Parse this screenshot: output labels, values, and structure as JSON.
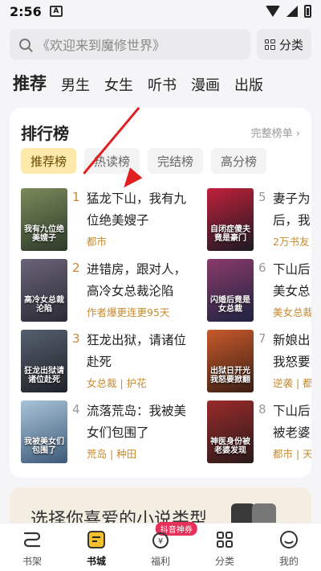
{
  "status_bar": {
    "time": "2:56",
    "notification_letter": "A"
  },
  "search": {
    "placeholder": "《欢迎来到魔修世界》",
    "category_label": "分类"
  },
  "top_tabs": [
    {
      "label": "推荐",
      "active": true
    },
    {
      "label": "男生",
      "active": false
    },
    {
      "label": "女生",
      "active": false
    },
    {
      "label": "听书",
      "active": false
    },
    {
      "label": "漫画",
      "active": false
    },
    {
      "label": "出版",
      "active": false
    }
  ],
  "ranking": {
    "title": "排行榜",
    "more_label": "完整榜单",
    "tabs": [
      {
        "label": "推荐榜",
        "active": true
      },
      {
        "label": "热读榜",
        "active": false
      },
      {
        "label": "完结榜",
        "active": false
      },
      {
        "label": "高分榜",
        "active": false
      }
    ],
    "left_books": [
      {
        "rank": "1",
        "title": "猛龙下山，我有九位绝美嫂子",
        "tag": "都市",
        "cover_text": "我有九位绝美嫂子",
        "cover_colors": [
          "#2d3a2a",
          "#7a8a5a"
        ]
      },
      {
        "rank": "2",
        "title": "进错房，跟对人，高冷女总裁沦陷",
        "tag": "作者爆更连更95天",
        "cover_text": "高冷女总裁沦陷",
        "cover_colors": [
          "#2a2a35",
          "#6a6478"
        ]
      },
      {
        "rank": "3",
        "title": "狂龙出狱，请诸位赴死",
        "tag": "女总裁 | 护花",
        "cover_text": "狂龙出狱请诸位赴死",
        "cover_colors": [
          "#1f2229",
          "#55606e"
        ]
      },
      {
        "rank": "4",
        "title": "流落荒岛：我被美女们包围了",
        "tag": "荒岛 | 种田",
        "cover_text": "我被美女们包围了",
        "cover_colors": [
          "#3d5a78",
          "#a9c3d8"
        ]
      }
    ],
    "right_books": [
      {
        "rank": "5",
        "title": "妻子为后，我",
        "tag": "2万书友",
        "cover_text": "自闭症傻夫竟是豪门",
        "cover_colors": [
          "#1a1a22",
          "#c0203a"
        ]
      },
      {
        "rank": "6",
        "title": "下山后美女总",
        "tag": "美女总裁",
        "cover_text": "闪婚后竟是女总裁",
        "cover_colors": [
          "#1e2340",
          "#8a3a6a"
        ]
      },
      {
        "rank": "7",
        "title": "新娘出我怒要",
        "tag": "逆袭 | 都",
        "cover_text": "出狱日开光我怒要掀翻",
        "cover_colors": [
          "#3a1f14",
          "#c7592a"
        ]
      },
      {
        "rank": "8",
        "title": "下山后被老婆",
        "tag": "都市 | 天",
        "cover_text": "神医身份被老婆发现",
        "cover_colors": [
          "#2a1a1a",
          "#9a2a2a"
        ]
      }
    ]
  },
  "promo": {
    "text": "选择你喜爱的小说类型"
  },
  "bottom_nav": [
    {
      "label": "书架",
      "icon": "bookshelf-icon",
      "active": false
    },
    {
      "label": "书城",
      "icon": "bookstore-icon",
      "active": true
    },
    {
      "label": "福利",
      "icon": "gift-icon",
      "active": false,
      "badge": "抖音神券"
    },
    {
      "label": "分类",
      "icon": "category-grid-icon",
      "active": false
    },
    {
      "label": "我的",
      "icon": "profile-icon",
      "active": false
    }
  ]
}
